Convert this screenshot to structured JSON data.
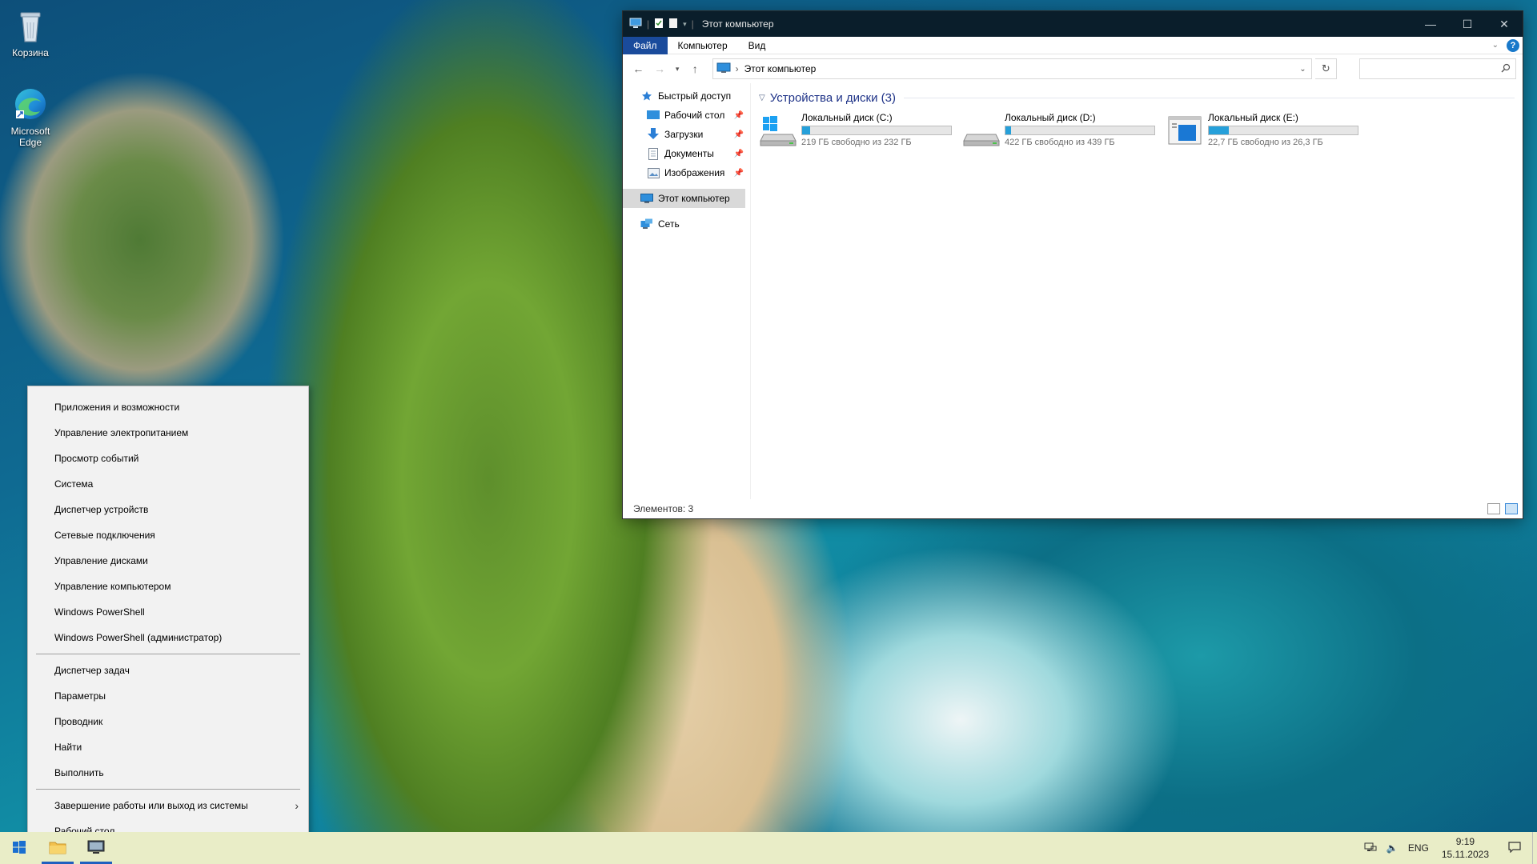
{
  "desktop": {
    "icons": [
      {
        "label": "Корзина",
        "icon": "recycle-bin-icon"
      },
      {
        "label": "Microsoft Edge",
        "icon": "edge-icon"
      }
    ]
  },
  "explorer": {
    "title": "Этот компьютер",
    "ribbon_tabs": [
      "Файл",
      "Компьютер",
      "Вид"
    ],
    "address": "Этот компьютер",
    "search_placeholder": "",
    "nav": {
      "quick_access": "Быстрый доступ",
      "quick_items": [
        "Рабочий стол",
        "Загрузки",
        "Документы",
        "Изображения"
      ],
      "this_pc": "Этот компьютер",
      "network": "Сеть"
    },
    "group_title": "Устройства и диски (3)",
    "drives": [
      {
        "name": "Локальный диск (C:)",
        "free": "219 ГБ свободно из 232 ГБ",
        "used_fraction": 0.056
      },
      {
        "name": "Локальный диск (D:)",
        "free": "422 ГБ свободно из 439 ГБ",
        "used_fraction": 0.039
      },
      {
        "name": "Локальный диск (E:)",
        "free": "22,7 ГБ свободно из 26,3 ГБ",
        "used_fraction": 0.137
      }
    ],
    "status": "Элементов: 3"
  },
  "winx_menu": {
    "group1": [
      "Приложения и возможности",
      "Управление электропитанием",
      "Просмотр событий",
      "Система",
      "Диспетчер устройств",
      "Сетевые подключения",
      "Управление дисками",
      "Управление компьютером",
      "Windows PowerShell",
      "Windows PowerShell (администратор)"
    ],
    "group2": [
      "Диспетчер задач",
      "Параметры",
      "Проводник",
      "Найти",
      "Выполнить"
    ],
    "group3": [
      "Завершение работы или выход из системы",
      "Рабочий стол"
    ]
  },
  "taskbar": {
    "language": "ENG",
    "time": "9:19",
    "date": "15.11.2023"
  },
  "colors": {
    "accent": "#1a4b9c",
    "drive_fill": "#26a0da",
    "group_header": "#1e3287",
    "titlebar": "#0a1e2b",
    "taskbar": "#e9edc7"
  }
}
